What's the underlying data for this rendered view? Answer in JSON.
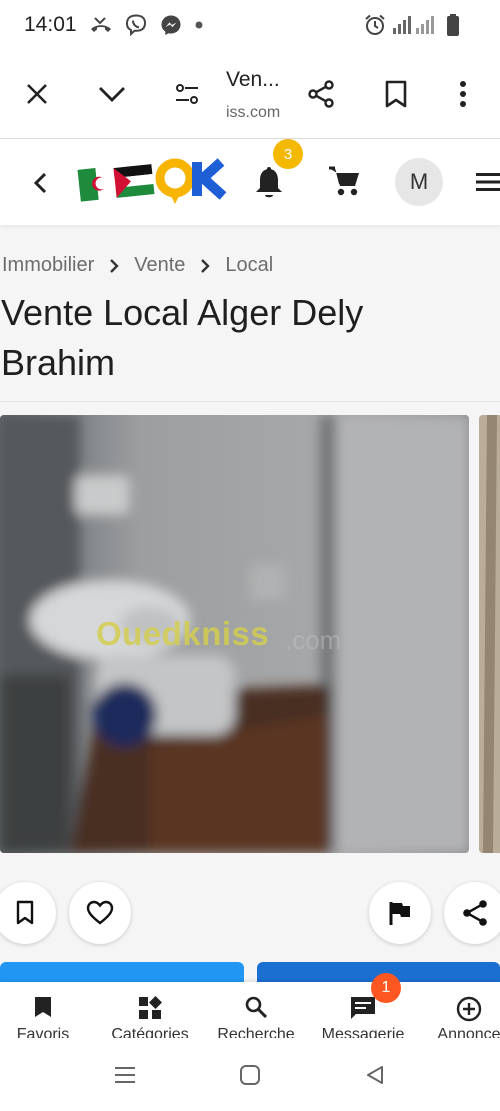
{
  "status_bar": {
    "time": "14:01",
    "left_icons": [
      "missed-call-icon",
      "viber-icon",
      "messenger-icon",
      "dot-icon"
    ],
    "right_icons": [
      "alarm-icon",
      "signal-icon",
      "battery-icon"
    ]
  },
  "browser": {
    "title": "Ven...",
    "url": "iss.com",
    "icons": [
      "close-icon",
      "chevron-down-icon",
      "tune-icon",
      "share-icon",
      "bookmark-icon",
      "more-vert-icon"
    ]
  },
  "site_header": {
    "logo_text": "OK",
    "notifications_count": "3",
    "avatar_letter": "M",
    "colors": {
      "logo_orange": "#f7b400",
      "logo_blue": "#1e5fd6",
      "badge": "#f5b800"
    }
  },
  "breadcrumb": [
    "Immobilier",
    "Vente",
    "Local"
  ],
  "title": "Vente Local Alger Dely Brahim",
  "photo": {
    "watermark": "Ouedkniss",
    "watermark_suffix": ".com"
  },
  "actions": {
    "left": [
      "bookmark-icon",
      "heart-icon"
    ],
    "right": [
      "flag-icon",
      "share-icon"
    ]
  },
  "bottom_nav": {
    "items": [
      {
        "label": "Favoris",
        "icon": "bookmark-icon"
      },
      {
        "label": "Catégories",
        "icon": "categories-icon"
      },
      {
        "label": "Recherche",
        "icon": "search-icon"
      },
      {
        "label": "Messagerie",
        "icon": "chat-icon"
      },
      {
        "label": "Annonce",
        "icon": "add-circle-icon"
      }
    ],
    "message_badge": "1",
    "colors": {
      "badge": "#ff5722"
    }
  },
  "android_nav": {
    "icons": [
      "recents-icon",
      "home-icon",
      "back-icon"
    ]
  }
}
